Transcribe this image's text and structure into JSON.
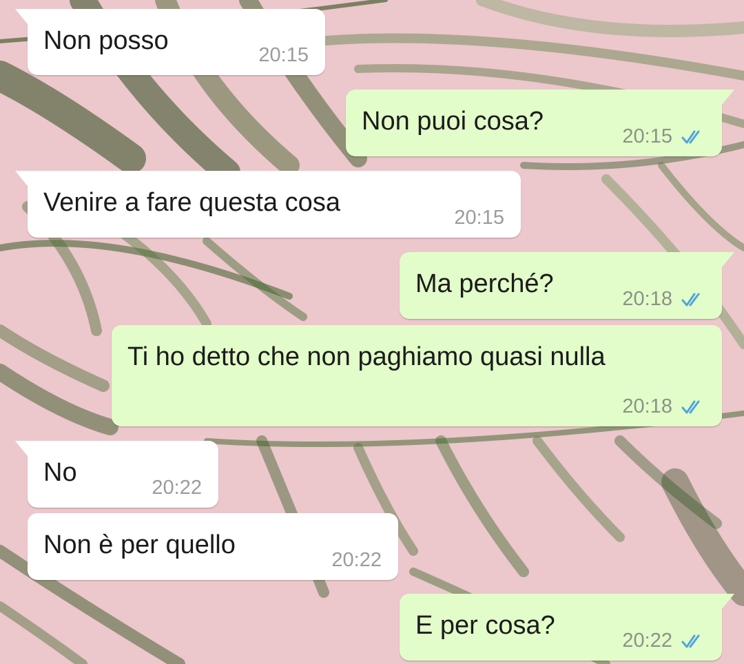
{
  "chat": {
    "messages": [
      {
        "id": "m1",
        "direction": "in",
        "text": "Non posso",
        "time": "20:15"
      },
      {
        "id": "m2",
        "direction": "out",
        "text": "Non puoi cosa?",
        "time": "20:15",
        "status": "read"
      },
      {
        "id": "m3",
        "direction": "in",
        "text": "Venire a fare questa cosa",
        "time": "20:15"
      },
      {
        "id": "m4",
        "direction": "out",
        "text": "Ma perché?",
        "time": "20:18",
        "status": "read"
      },
      {
        "id": "m5",
        "direction": "out",
        "text": "Ti ho detto che non paghiamo quasi nulla",
        "time": "20:18",
        "status": "read"
      },
      {
        "id": "m6",
        "direction": "in",
        "text": "No",
        "time": "20:22"
      },
      {
        "id": "m7",
        "direction": "in",
        "text": "Non è per quello",
        "time": "20:22"
      },
      {
        "id": "m8",
        "direction": "out",
        "text": "E per cosa?",
        "time": "20:22",
        "status": "read"
      }
    ]
  },
  "theme": {
    "incoming_bubble": "#ffffff",
    "outgoing_bubble": "#e2fdc9",
    "read_tick_color": "#4fa3e0",
    "wallpaper": "pink background with green palm leaves",
    "status_icon": "double-check-read-icon"
  }
}
